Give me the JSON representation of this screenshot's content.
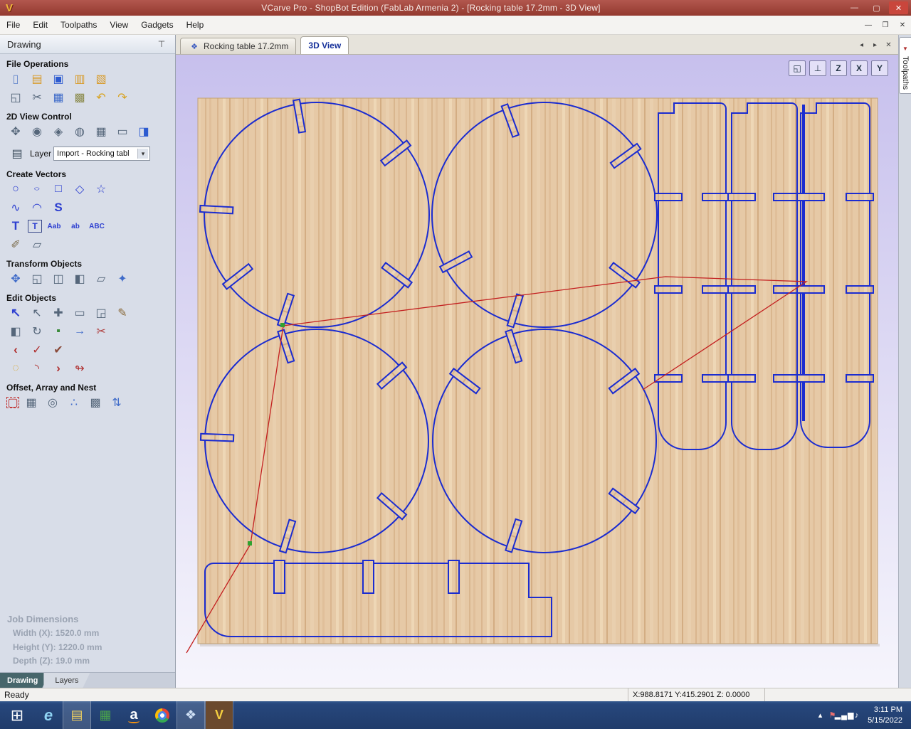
{
  "window": {
    "title": "VCarve Pro - ShopBot Edition (FabLab Armenia 2) - [Rocking table 17.2mm - 3D View]"
  },
  "menubar": {
    "items": [
      "File",
      "Edit",
      "Toolpaths",
      "View",
      "Gadgets",
      "Help"
    ]
  },
  "panel": {
    "title": "Drawing"
  },
  "tools": {
    "file_ops": {
      "title": "File Operations",
      "rows": [
        [
          {
            "n": "new-file",
            "g": "▯",
            "c": "#6688cc"
          },
          {
            "n": "open-file",
            "g": "▤",
            "c": "#d89a28"
          },
          {
            "n": "save-file",
            "g": "▣",
            "c": "#2d5bd0"
          },
          {
            "n": "open-recent-folder",
            "g": "▥",
            "c": "#d89a28"
          },
          {
            "n": "import-vectors",
            "g": "▧",
            "c": "#d89a28"
          }
        ],
        [
          {
            "n": "job-setup",
            "g": "◱",
            "c": "#55667a"
          },
          {
            "n": "cut",
            "g": "✂",
            "c": "#55667a"
          },
          {
            "n": "copy",
            "g": "▦",
            "c": "#3f6bc9"
          },
          {
            "n": "paste",
            "g": "▩",
            "c": "#8a8a4a"
          },
          {
            "n": "undo",
            "g": "↶",
            "c": "#d8a21e"
          },
          {
            "n": "redo",
            "g": "↷",
            "c": "#d8a21e"
          }
        ]
      ]
    },
    "view2d": {
      "title": "2D View Control",
      "rows": [
        [
          {
            "n": "pan-view",
            "g": "✥",
            "c": "#55667a"
          },
          {
            "n": "zoom-interactive",
            "g": "◉",
            "c": "#55667a"
          },
          {
            "n": "zoom-box",
            "g": "◈",
            "c": "#55667a"
          },
          {
            "n": "zoom-selected",
            "g": "◍",
            "c": "#55667a"
          },
          {
            "n": "zoom-extents",
            "g": "▦",
            "c": "#55667a"
          },
          {
            "n": "zoom-sheet",
            "g": "▭",
            "c": "#55667a"
          },
          {
            "n": "switch-2d-3d",
            "g": "◨",
            "c": "#2d5bd0"
          }
        ]
      ]
    },
    "layer": {
      "label": "Layer",
      "value": "Import - Rocking tabl"
    },
    "create": {
      "title": "Create Vectors",
      "rows": [
        [
          {
            "n": "draw-circle",
            "g": "○",
            "c": "#2d3fd0"
          },
          {
            "n": "draw-ellipse",
            "g": "○",
            "c": "#2d3fd0",
            "cls": "squash"
          },
          {
            "n": "draw-rectangle",
            "g": "□",
            "c": "#2d3fd0"
          },
          {
            "n": "draw-polygon",
            "g": "◇",
            "c": "#2d3fd0"
          },
          {
            "n": "draw-star",
            "g": "☆",
            "c": "#2d3fd0"
          }
        ],
        [
          {
            "n": "draw-polyline",
            "g": "∿",
            "c": "#2d3fd0"
          },
          {
            "n": "draw-arc",
            "g": "◠",
            "c": "#2d3fd0"
          },
          {
            "n": "draw-curve",
            "g": "S",
            "c": "#2d3fd0",
            "cls": "bold"
          }
        ],
        [
          {
            "n": "draw-text",
            "g": "T",
            "c": "#2d3fd0",
            "cls": "bold"
          },
          {
            "n": "draw-text-box",
            "g": "T",
            "c": "#2d3fd0",
            "cls": "boxed"
          },
          {
            "n": "text-auto-size",
            "g": "Aab",
            "c": "#2d3fd0",
            "cls": "small"
          },
          {
            "n": "text-on-curve",
            "g": "ab",
            "c": "#2d3fd0",
            "cls": "small"
          },
          {
            "n": "convert-text-to-curves",
            "g": "ABC",
            "c": "#2d3fd0",
            "cls": "small"
          }
        ],
        [
          {
            "n": "vector-paint",
            "g": "✐",
            "c": "#7a6a4a"
          },
          {
            "n": "trim-vectors",
            "g": "▱",
            "c": "#55667a"
          }
        ]
      ]
    },
    "transform": {
      "title": "Transform Objects",
      "rows": [
        [
          {
            "n": "move-selection",
            "g": "✥",
            "c": "#3f6bc9"
          },
          {
            "n": "set-size",
            "g": "◱",
            "c": "#55667a"
          },
          {
            "n": "center-in-material",
            "g": "◫",
            "c": "#55667a"
          },
          {
            "n": "mirror-objects",
            "g": "◧",
            "c": "#55667a"
          },
          {
            "n": "distort-object",
            "g": "▱",
            "c": "#55667a"
          },
          {
            "n": "align-objects",
            "g": "✦",
            "c": "#3f6bc9"
          }
        ]
      ]
    },
    "edit": {
      "title": "Edit Objects",
      "rows": [
        [
          {
            "n": "select-tool",
            "g": "↖",
            "c": "#2d3fd0",
            "cls": "bold"
          },
          {
            "n": "node-edit-tool",
            "g": "↖",
            "c": "#55667a"
          },
          {
            "n": "quick-select",
            "g": "✚",
            "c": "#55667a"
          },
          {
            "n": "measure-tool",
            "g": "▭",
            "c": "#55667a"
          },
          {
            "n": "delete-tool",
            "g": "◲",
            "c": "#55667a"
          },
          {
            "n": "edit-pencil",
            "g": "✎",
            "c": "#8a6a3a"
          }
        ],
        [
          {
            "n": "group-objects",
            "g": "◧",
            "c": "#55667a"
          },
          {
            "n": "rotate-objects",
            "g": "↻",
            "c": "#55667a"
          },
          {
            "n": "fill-region",
            "g": "▪",
            "c": "#3a8a3a"
          },
          {
            "n": "direction-arrow",
            "g": "→",
            "c": "#3f6bc9"
          },
          {
            "n": "cut-object",
            "g": "✂",
            "c": "#b04040"
          }
        ],
        [
          {
            "n": "join-vectors",
            "g": "‹",
            "c": "#b03030",
            "cls": "bold"
          },
          {
            "n": "close-vector",
            "g": "✓",
            "c": "#b03030"
          },
          {
            "n": "fit-curves",
            "g": "✔",
            "c": "#8a4a3a"
          }
        ],
        [
          {
            "n": "create-fillet",
            "g": "◌",
            "c": "#d8a21e"
          },
          {
            "n": "arc-edit",
            "g": "◝",
            "c": "#b03030"
          },
          {
            "n": "extend-vector",
            "g": "›",
            "c": "#b03030",
            "cls": "bold"
          },
          {
            "n": "curve-flow",
            "g": "↬",
            "c": "#b03030"
          }
        ]
      ]
    },
    "offset": {
      "title": "Offset, Array and Nest",
      "rows": [
        [
          {
            "n": "offset-vectors",
            "g": "▢",
            "c": "#c03030",
            "cls": "dashedicon"
          },
          {
            "n": "array-copy",
            "g": "▦",
            "c": "#55667a"
          },
          {
            "n": "circular-copy",
            "g": "◎",
            "c": "#55667a"
          },
          {
            "n": "copy-along-vectors",
            "g": "∴",
            "c": "#3f6bc9"
          },
          {
            "n": "nest-parts",
            "g": "▩",
            "c": "#55667a"
          },
          {
            "n": "z-order-sort",
            "g": "⇅",
            "c": "#3f6bc9"
          }
        ]
      ]
    }
  },
  "job": {
    "title": "Job Dimensions",
    "width": "Width (X): 1520.0 mm",
    "height": "Height (Y): 1220.0 mm",
    "depth": "Depth (Z): 19.0 mm"
  },
  "panel_tabs": [
    "Drawing",
    "Layers"
  ],
  "doc_tabs": [
    {
      "label": "Rocking table 17.2mm"
    },
    {
      "label": "3D View"
    }
  ],
  "right_tab": {
    "label": "Toolpaths"
  },
  "status": {
    "ready": "Ready",
    "coords": "X:988.8171 Y:415.2901 Z:  0.0000"
  },
  "taskbar": {
    "time": "3:11 PM",
    "date": "5/15/2022",
    "icons": [
      {
        "n": "start-button",
        "g": "⊞",
        "c": "#ffffff",
        "cls": "start"
      },
      {
        "n": "internet-explorer",
        "g": "e",
        "c": "#8fd4f4",
        "cls": "ie"
      },
      {
        "n": "file-explorer",
        "g": "▤",
        "c": "#f0d060",
        "cls": "open"
      },
      {
        "n": "office-app",
        "g": "▦",
        "c": "#4aa34a"
      },
      {
        "n": "amazon-app",
        "g": "a",
        "c": "#ffffff",
        "cls": "amazon"
      },
      {
        "n": "chrome",
        "g": "",
        "c": "",
        "cls": "chrome"
      },
      {
        "n": "cad-app",
        "g": "❖",
        "c": "#cfe0f5",
        "cls": "open"
      },
      {
        "n": "vcarve-app",
        "g": "V",
        "c": "#f5d040",
        "cls": "open vcarve"
      }
    ],
    "tray": [
      {
        "n": "tray-expand",
        "g": "▴",
        "c": "#ffffff"
      },
      {
        "n": "tray-flag",
        "g": "⚑",
        "c": "#e87070"
      },
      {
        "n": "tray-network",
        "g": "▂▄▆",
        "c": "#ffffff",
        "cls": "tiny"
      },
      {
        "n": "tray-volume",
        "g": "♪",
        "c": "#ffffff"
      }
    ]
  },
  "icons": {
    "app_logo": [
      {
        "n": "app-logo",
        "g": "V",
        "c": "#f0b838",
        "cls": "logo",
        "i": false
      }
    ],
    "win_controls": [
      {
        "n": "minimize-button",
        "g": "—",
        "c": "#f5e8e4"
      },
      {
        "n": "maximize-button",
        "g": "▢",
        "c": "#f5e8e4"
      },
      {
        "n": "close-button",
        "g": "✕",
        "c": "#ffffff",
        "cls": "closebtn"
      }
    ],
    "mdi_controls": [
      {
        "n": "mdi-minimize-button",
        "g": "—",
        "c": "#333333"
      },
      {
        "n": "mdi-restore-button",
        "g": "❐",
        "c": "#333333"
      },
      {
        "n": "mdi-close-button",
        "g": "✕",
        "c": "#333333"
      }
    ],
    "pin": [
      {
        "n": "pin",
        "g": "⊤",
        "c": "#444444"
      }
    ],
    "layer_icon": [
      {
        "n": "layers",
        "g": "▤",
        "c": "#3a4a5a",
        "i": false
      }
    ],
    "dropdown_arrow": [
      {
        "n": "dropdown-arrow",
        "g": "▾",
        "c": "#333333"
      }
    ],
    "doc_tab_icon": [
      {
        "n": "document-icon",
        "g": "❖",
        "c": "#3a5ac0",
        "i": false
      }
    ],
    "tab_nav": [
      {
        "n": "tab-scroll-left",
        "g": "◂",
        "c": "#444444"
      },
      {
        "n": "tab-scroll-right",
        "g": "▸",
        "c": "#444444"
      },
      {
        "n": "tab-close",
        "g": "✕",
        "c": "#444444"
      }
    ],
    "right_tab_icon": [
      {
        "n": "toolpaths-icon",
        "g": "▼",
        "c": "#b03030",
        "i": false
      }
    ],
    "view_icons": [
      {
        "n": "view-zoom-extents",
        "g": "◱",
        "c": "#223344"
      },
      {
        "n": "view-iso",
        "g": "⊥",
        "c": "#223344"
      },
      {
        "n": "view-plane-z",
        "g": "Z",
        "c": "#223344",
        "cls": "small"
      },
      {
        "n": "view-plane-x",
        "g": "X",
        "c": "#223344",
        "cls": "small"
      },
      {
        "n": "view-plane-y",
        "g": "Y",
        "c": "#223344",
        "cls": "small"
      }
    ]
  },
  "colors": {
    "vector_blue": "#1b2cd0",
    "toolpath_red": "#c32020",
    "wood_base": "#e6c9a6",
    "canvas_top": "#c7c0ed"
  }
}
